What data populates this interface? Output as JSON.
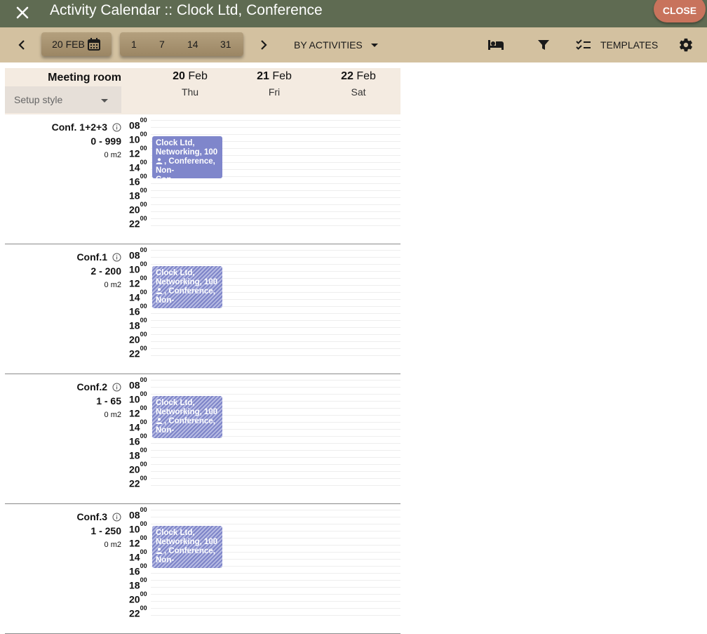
{
  "titlebar": {
    "title": "Activity Calendar :: Clock Ltd, Conference",
    "close_label": "CLOSE"
  },
  "toolbar": {
    "date_label": "20 FEB",
    "range_options": [
      "1",
      "7",
      "14",
      "31"
    ],
    "view_label": "BY ACTIVITIES",
    "templates_label": "TEMPLATES",
    "icons": [
      "chevron-left-icon",
      "calendar-icon",
      "chevron-right-icon",
      "bed-icon",
      "filter-icon",
      "checklist-icon",
      "gear-icon"
    ]
  },
  "calendar": {
    "column_title": "Meeting room",
    "setup_placeholder": "Setup style",
    "days": [
      {
        "num": "20",
        "month": "Feb",
        "weekday": "Thu"
      },
      {
        "num": "21",
        "month": "Feb",
        "weekday": "Fri"
      },
      {
        "num": "22",
        "month": "Feb",
        "weekday": "Sat"
      }
    ],
    "hours": [
      "08",
      "10",
      "12",
      "14",
      "16",
      "18",
      "20",
      "22"
    ],
    "minutes": "00"
  },
  "rooms": [
    {
      "name": "Conf. 1+2+3",
      "capacity": "0 - 999",
      "area": "0 m2",
      "event": {
        "line1": "Clock Ltd,",
        "line2": "Networking, 100",
        "line3": ", Conference,",
        "line4": "Non-",
        "line5": "Con...",
        "style": "solid"
      }
    },
    {
      "name": "Conf.1",
      "capacity": "2 - 200",
      "area": "0 m2",
      "event": {
        "line1": "Clock Ltd,",
        "line2": "Networking, 100",
        "line3": ", Conference,",
        "line4": "Non-",
        "style": "hatch"
      }
    },
    {
      "name": "Conf.2",
      "capacity": "1 - 65",
      "area": "0 m2",
      "event": {
        "line1": "Clock Ltd,",
        "line2": "Networking, 100",
        "line3": ", Conference,",
        "line4": "Non-",
        "style": "hatch"
      }
    },
    {
      "name": "Conf.3",
      "capacity": "1 - 250",
      "area": "0 m2",
      "event": {
        "line1": "Clock Ltd,",
        "line2": "Networking, 100",
        "line3": ", Conference,",
        "line4": "Non-",
        "style": "hatch"
      }
    }
  ],
  "colors": {
    "titlebar": "#5f6b52",
    "toolbar": "#d3c1a0",
    "close_button": "#c8735c",
    "event": "#7f86cb",
    "header_bg": "#f4ebe1"
  }
}
